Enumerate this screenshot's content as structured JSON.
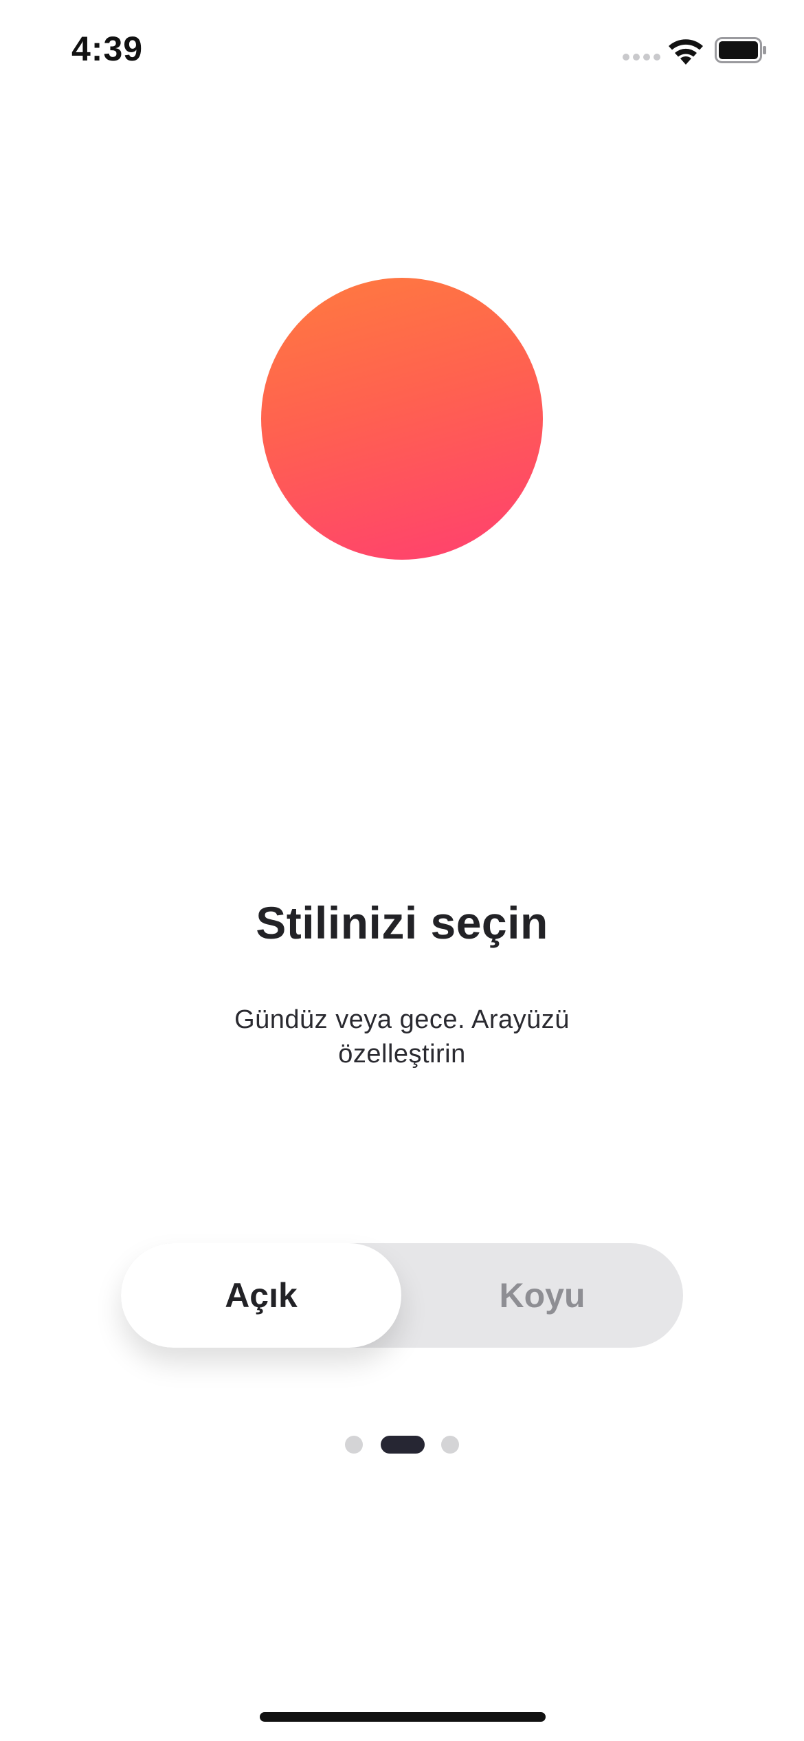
{
  "status_bar": {
    "time": "4:39",
    "signal_icon": "signal-dots-icon",
    "wifi_icon": "wifi-icon",
    "battery_icon": "battery-full-icon"
  },
  "hero": {
    "icon": "gradient-circle-illustration",
    "gradient_colors": [
      "#ff7b3f",
      "#ff6150",
      "#ff3f70"
    ]
  },
  "onboarding": {
    "title": "Stilinizi seçin",
    "subtitle_line1": "Gündüz veya gece. Arayüzü",
    "subtitle_line2": "özelleştirin"
  },
  "theme_toggle": {
    "options": [
      {
        "label": "Açık",
        "selected": true
      },
      {
        "label": "Koyu",
        "selected": false
      }
    ],
    "selected_color": "#222226",
    "unselected_color": "#8e8e93",
    "track_color": "#e6e6e8"
  },
  "pager": {
    "total_pages": 3,
    "current_page": 2,
    "active_color": "#262633",
    "inactive_color": "#d4d4d6"
  }
}
